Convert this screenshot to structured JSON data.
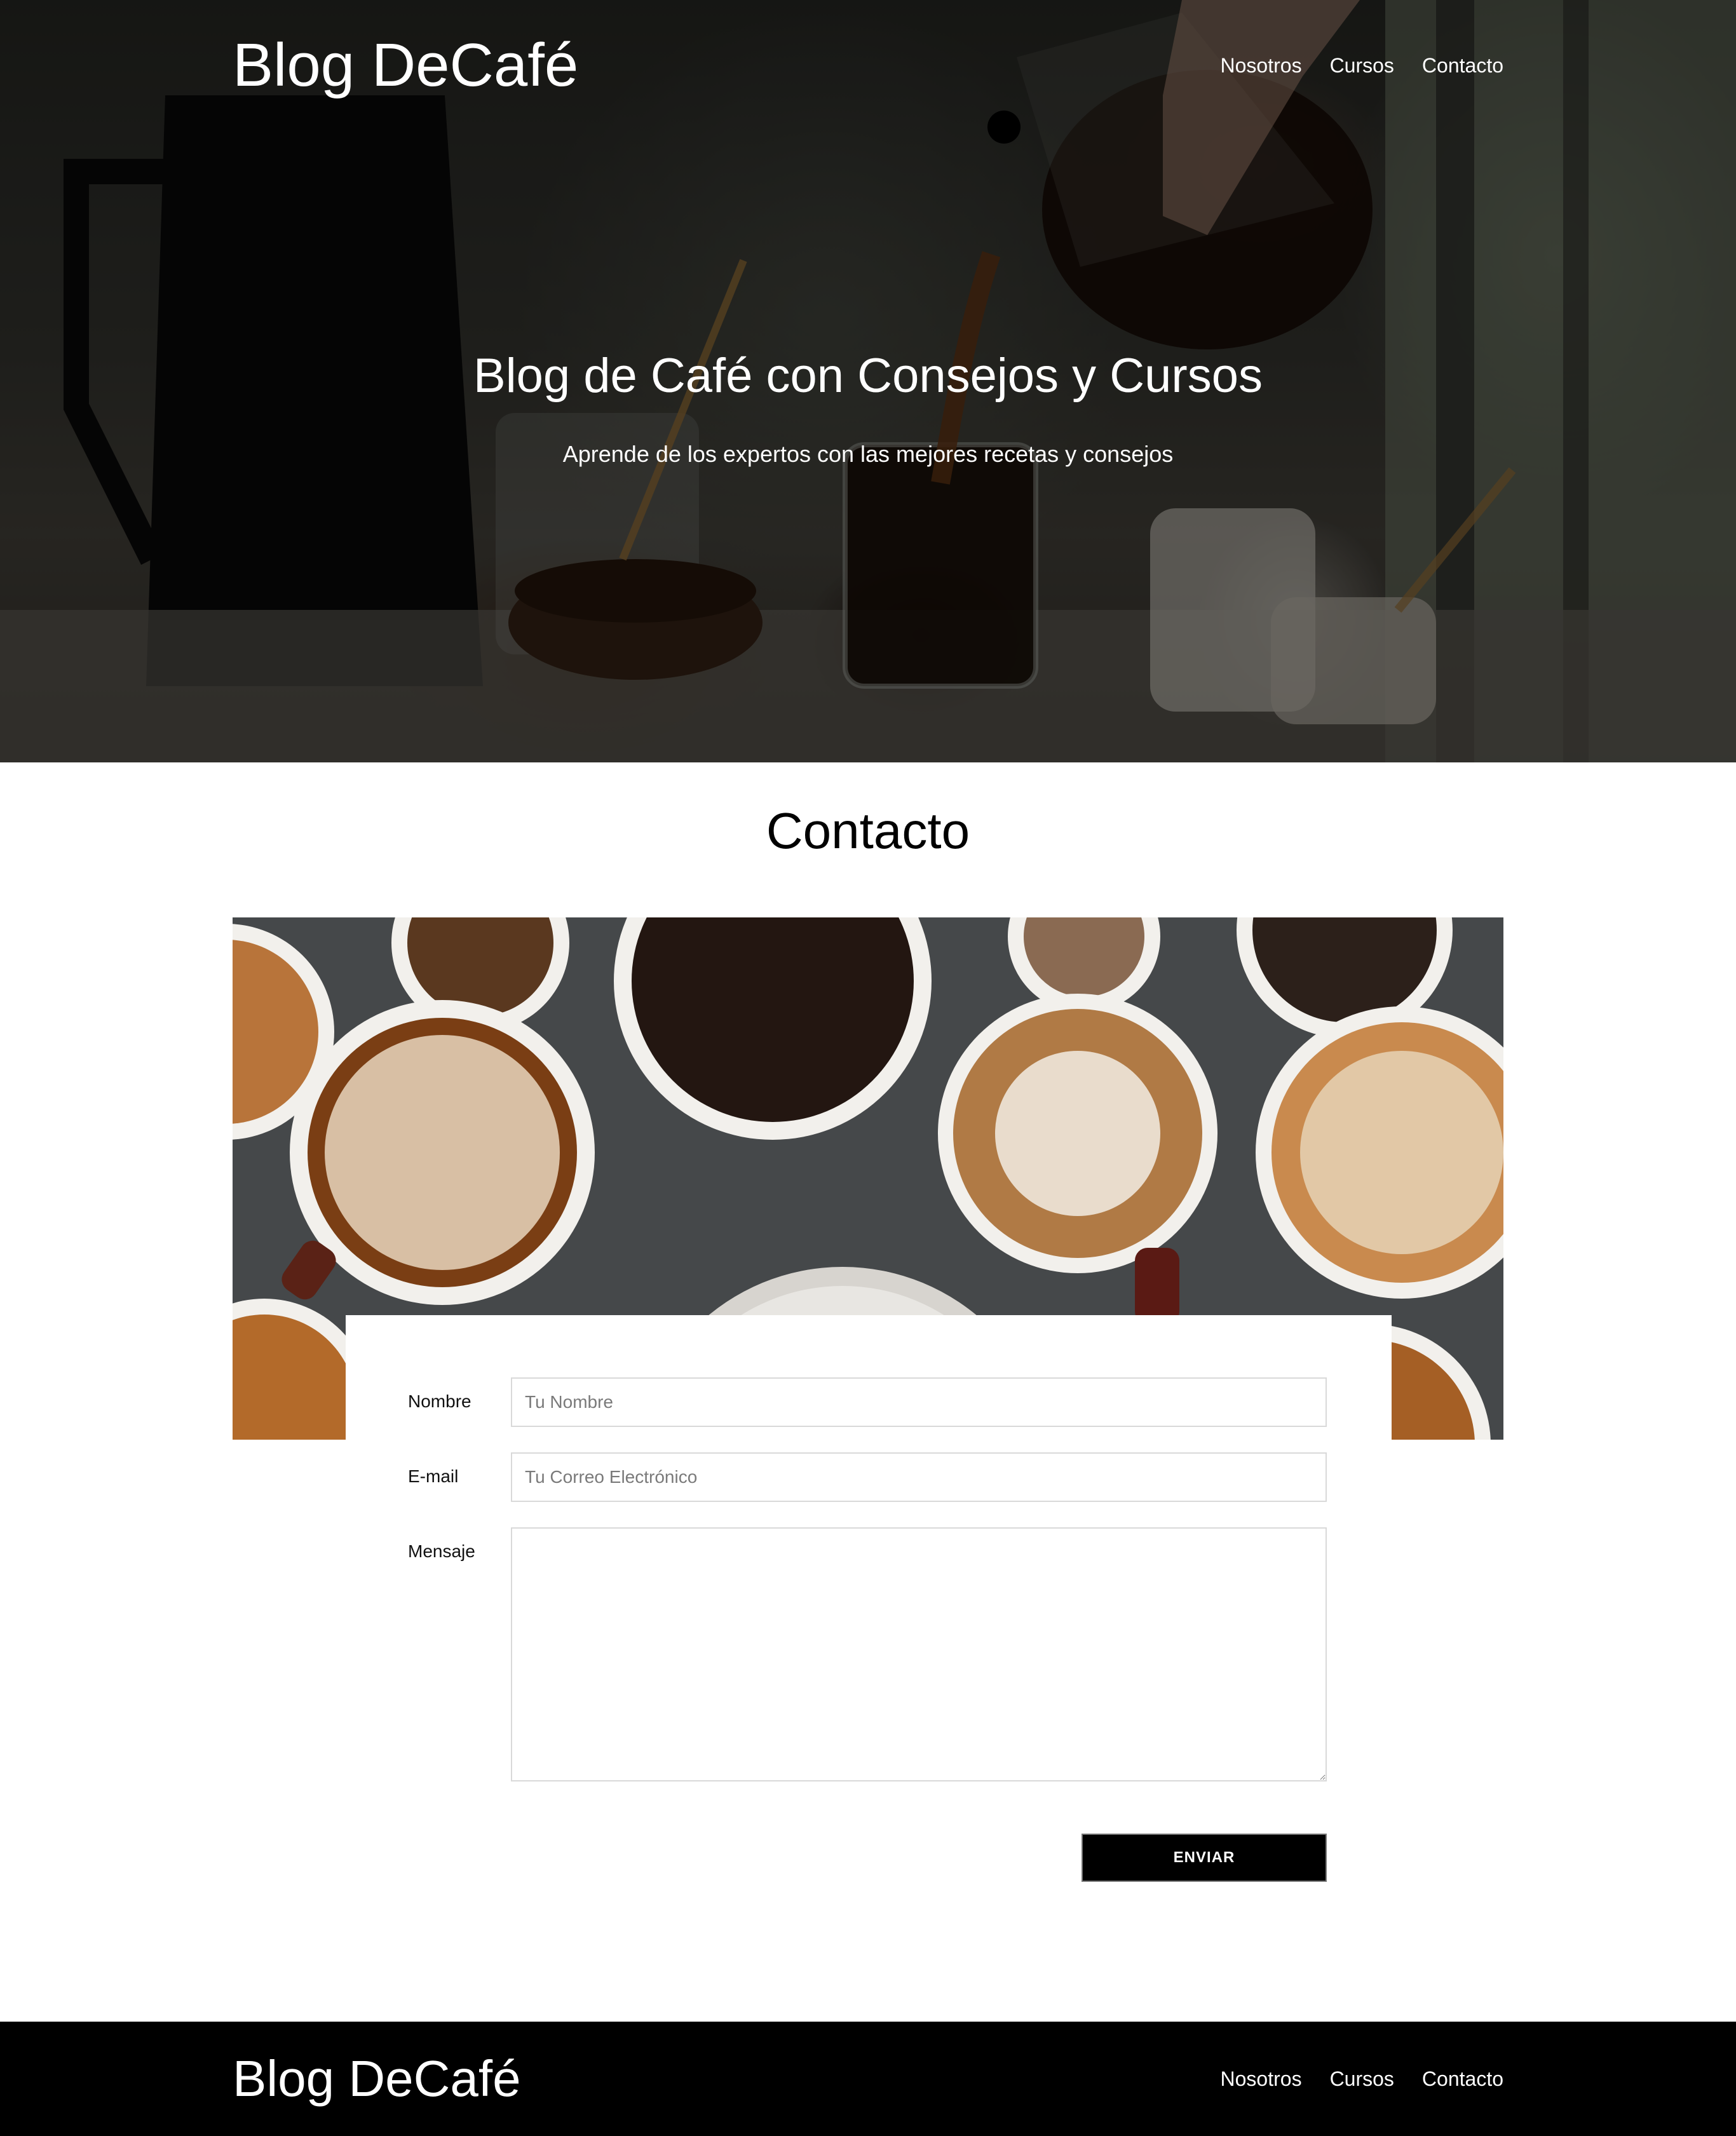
{
  "site": {
    "brand_light": "Blog",
    "brand_bold": "DeCafé",
    "nav": [
      "Nosotros",
      "Cursos",
      "Contacto"
    ]
  },
  "hero": {
    "title": "Blog de Café con Consejos y Cursos",
    "subtitle": "Aprende de los expertos con las mejores recetas y consejos"
  },
  "contact": {
    "title": "Contacto",
    "form": {
      "name_label": "Nombre",
      "name_placeholder": "Tu Nombre",
      "email_label": "E-mail",
      "email_placeholder": "Tu Correo Electrónico",
      "message_label": "Mensaje",
      "submit_label": "ENVIAR"
    }
  },
  "footer": {
    "brand_light": "Blog",
    "brand_bold": "DeCafé",
    "nav": [
      "Nosotros",
      "Cursos",
      "Contacto"
    ]
  }
}
